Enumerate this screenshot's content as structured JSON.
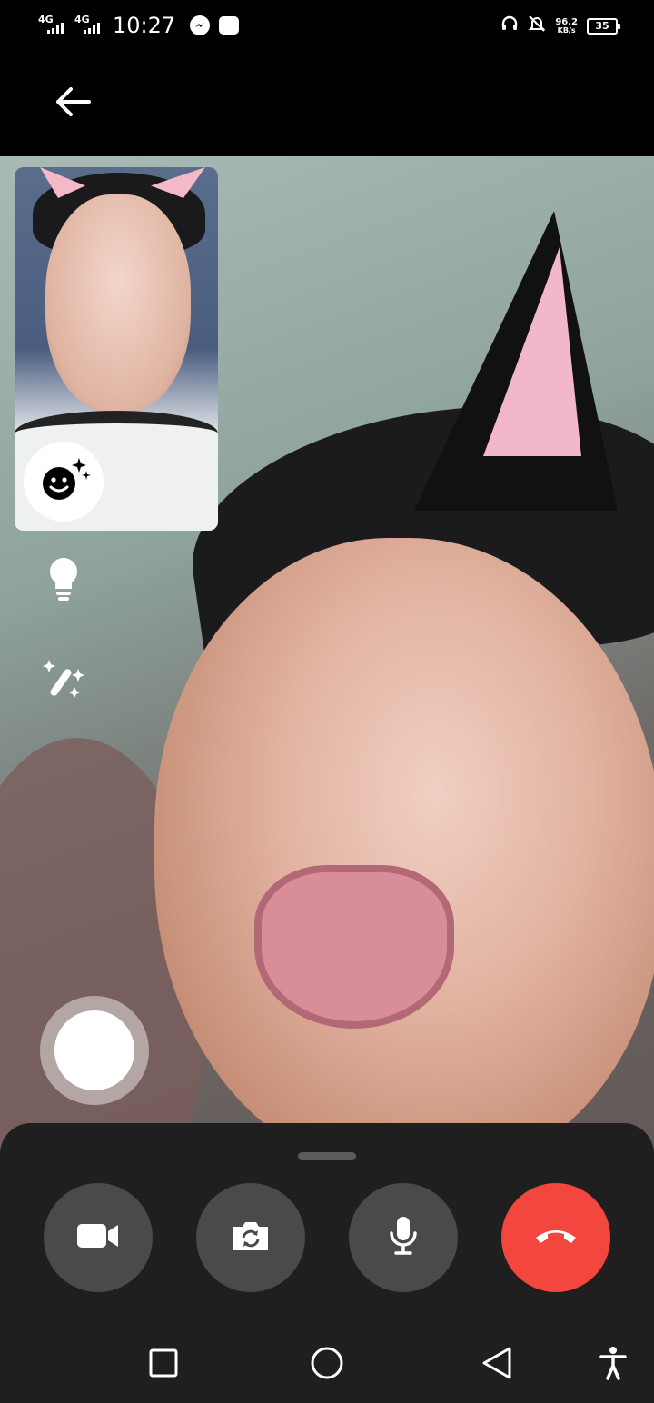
{
  "status_bar": {
    "network1": "4G",
    "network2": "4G",
    "time": "10:27",
    "speed_value": "96.2",
    "speed_unit": "KB/s",
    "battery": "35"
  },
  "icons": {
    "back": "back-arrow-icon",
    "effects": "smiley-sparkle-icon",
    "light": "lightbulb-icon",
    "magic": "magic-wand-icon",
    "video": "video-camera-icon",
    "flip": "flip-camera-icon",
    "mic": "microphone-icon",
    "end": "end-call-icon"
  },
  "colors": {
    "end_call": "#f3463e",
    "control_bg": "#4a4a4a",
    "sheet_bg": "#1f1f1f"
  }
}
